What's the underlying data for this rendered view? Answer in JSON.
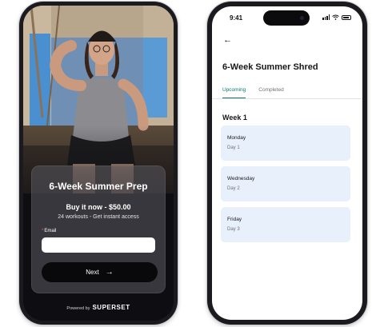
{
  "checkout": {
    "title": "6-Week Summer Prep",
    "price_line": "Buy it now - $50.00",
    "subtitle": "24 workouts - Get instant access",
    "email_label": "Email",
    "email_required_mark": "*",
    "email_value": "",
    "next_label": "Next",
    "powered_by": "Powered by",
    "brand": "SUPERSET",
    "icons": {
      "next": "arrow-right-icon"
    },
    "colors": {
      "button_bg": "#09090b",
      "card_bg": "#5a5a60"
    }
  },
  "program": {
    "status_time": "9:41",
    "title": "6-Week Summer Shred",
    "tabs": [
      {
        "label": "Upcoming",
        "active": true
      },
      {
        "label": "Completed",
        "active": false
      }
    ],
    "week_title": "Week 1",
    "days": [
      {
        "name": "Monday",
        "label": "Day 1"
      },
      {
        "name": "Wednesday",
        "label": "Day 2"
      },
      {
        "name": "Friday",
        "label": "Day 3"
      }
    ],
    "icons": {
      "back": "back-arrow-icon"
    },
    "colors": {
      "accent": "#0f766e",
      "day_card_bg": "#e8f0fb"
    }
  }
}
